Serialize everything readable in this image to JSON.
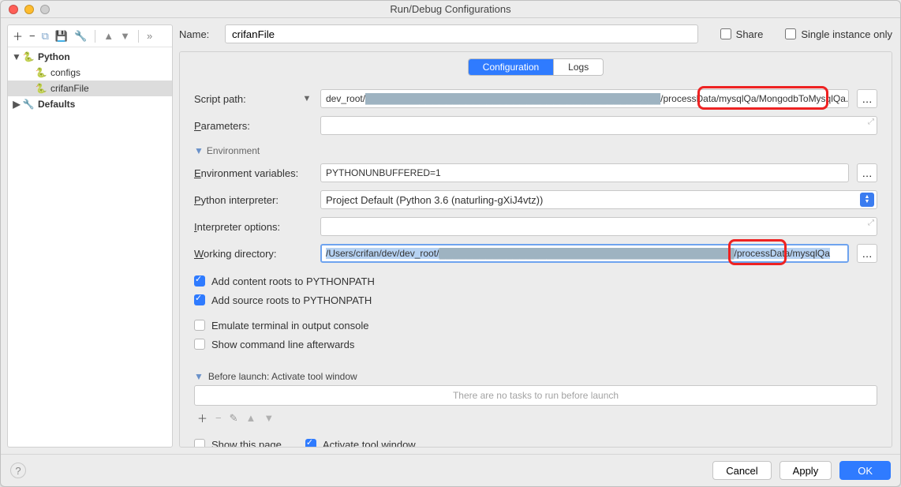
{
  "window": {
    "title": "Run/Debug Configurations"
  },
  "sidebar": {
    "nodes": {
      "python": "Python",
      "configs": "configs",
      "crifanFile": "crifanFile",
      "defaults": "Defaults"
    }
  },
  "name": {
    "label": "Name:",
    "value": "crifanFile"
  },
  "options": {
    "share": "Share",
    "single_instance": "Single instance only"
  },
  "tabs": {
    "configuration": "Configuration",
    "logs": "Logs"
  },
  "form": {
    "script_path_label": "Script path:",
    "script_path_pre": "dev_root/",
    "script_path_redact": "████████████████████████████████████████████",
    "script_path_post": "/processData/mysqlQa/MongodbToMysqlQa.py",
    "parameters_label": "Parameters:",
    "parameters_value": "",
    "env_section": "Environment",
    "env_vars_label": "Environment variables:",
    "env_vars_value": "PYTHONUNBUFFERED=1",
    "interpreter_label": "Python interpreter:",
    "interpreter_value": "Project Default (Python 3.6 (naturling-gXiJ4vtz))",
    "interp_opts_label": "Interpreter options:",
    "interp_opts_value": "",
    "workdir_label": "Working directory:",
    "workdir_pre": "/Users/crifan/dev/dev_root/",
    "workdir_redact": "████████████████████████████████████████████",
    "workdir_post1": "/processData",
    "workdir_post2": "/mysqlQa"
  },
  "checks": {
    "content_roots": "Add content roots to PYTHONPATH",
    "source_roots": "Add source roots to PYTHONPATH",
    "emulate_terminal": "Emulate terminal in output console",
    "show_cmdline": "Show command line afterwards"
  },
  "before_launch": {
    "label": "Before launch: Activate tool window",
    "empty": "There are no tasks to run before launch",
    "show_page": "Show this page",
    "activate_tool": "Activate tool window"
  },
  "buttons": {
    "cancel": "Cancel",
    "apply": "Apply",
    "ok": "OK"
  },
  "underlines": {
    "N": "N",
    "ame": "ame:",
    "P_params": "P",
    "arameters": "arameters:",
    "E_env": "E",
    "nvironment": "nvironment variables:",
    "P_py": "P",
    "ython": "ython interpreter:",
    "I_int": "I",
    "nterpreter": "nterpreter options:",
    "W_work": "W",
    "orking": "orking directory:",
    "B_bl": "B",
    "efore": "efore launch: Activate tool window"
  }
}
